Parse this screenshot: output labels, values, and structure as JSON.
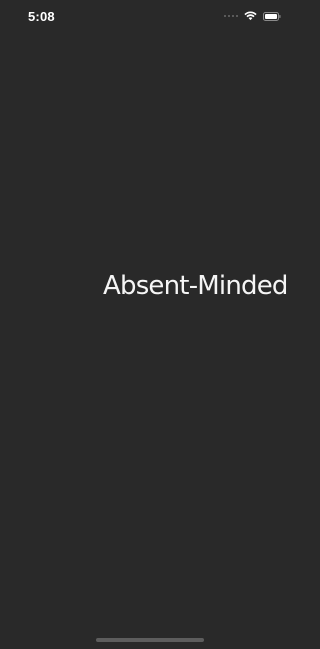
{
  "status_bar": {
    "time": "5:08",
    "icons": [
      "signal-dots-icon",
      "wifi-icon",
      "battery-icon"
    ]
  },
  "main": {
    "title": "Absent-Minded"
  },
  "colors": {
    "background": "#292929",
    "text": "#f5f5f5",
    "home_indicator": "#5d5d5d"
  }
}
